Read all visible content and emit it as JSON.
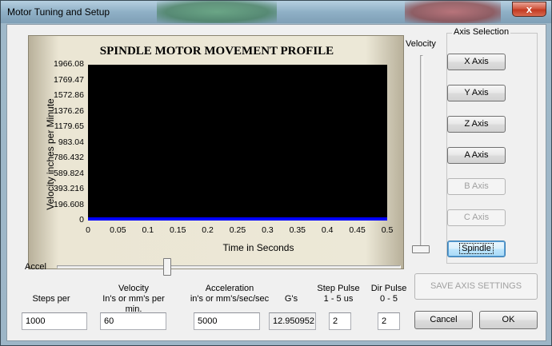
{
  "window": {
    "title": "Motor Tuning and Setup",
    "close_glyph": "x"
  },
  "chart_data": {
    "type": "line",
    "title": "SPINDLE MOTOR MOVEMENT PROFILE",
    "xlabel": "Time in Seconds",
    "ylabel": "Velocity inches per Minute",
    "x_ticks": [
      "0",
      "0.05",
      "0.1",
      "0.15",
      "0.2",
      "0.25",
      "0.3",
      "0.35",
      "0.4",
      "0.45",
      "0.5"
    ],
    "y_ticks": [
      "0",
      "196.608",
      "393.216",
      "589.824",
      "786.432",
      "983.04",
      "1179.65",
      "1376.26",
      "1572.86",
      "1769.47",
      "1966.08"
    ],
    "xlim": [
      0,
      0.5
    ],
    "ylim": [
      0,
      1966.08
    ],
    "series": [
      {
        "x": [
          0,
          0.5
        ],
        "y": [
          0,
          0
        ],
        "color": "#0000ff"
      }
    ],
    "plot_background": "#000000"
  },
  "velocity_slider": {
    "label": "Velocity"
  },
  "axis_selection": {
    "label": "Axis Selection",
    "buttons": [
      {
        "label": "X Axis",
        "enabled": true
      },
      {
        "label": "Y Axis",
        "enabled": true
      },
      {
        "label": "Z Axis",
        "enabled": true
      },
      {
        "label": "A Axis",
        "enabled": true
      },
      {
        "label": "B Axis",
        "enabled": false
      },
      {
        "label": "C Axis",
        "enabled": false
      },
      {
        "label": "Spindle",
        "enabled": true,
        "selected": true
      }
    ]
  },
  "accel_slider": {
    "label": "Accel"
  },
  "fields": {
    "steps_per": {
      "label": "Steps per",
      "value": "1000"
    },
    "velocity": {
      "label1": "Velocity",
      "label2": "In's or mm's per min.",
      "value": "60"
    },
    "acceleration": {
      "label1": "Acceleration",
      "label2": "in's or mm's/sec/sec",
      "value": "5000"
    },
    "gs": {
      "label": "G's",
      "value": "12.950952"
    },
    "step_pulse": {
      "label1": "Step Pulse",
      "label2": "1 - 5 us",
      "value": "2"
    },
    "dir_pulse": {
      "label1": "Dir Pulse",
      "label2": "0 - 5",
      "value": "2"
    }
  },
  "buttons": {
    "save": "SAVE AXIS SETTINGS",
    "cancel": "Cancel",
    "ok": "OK"
  }
}
